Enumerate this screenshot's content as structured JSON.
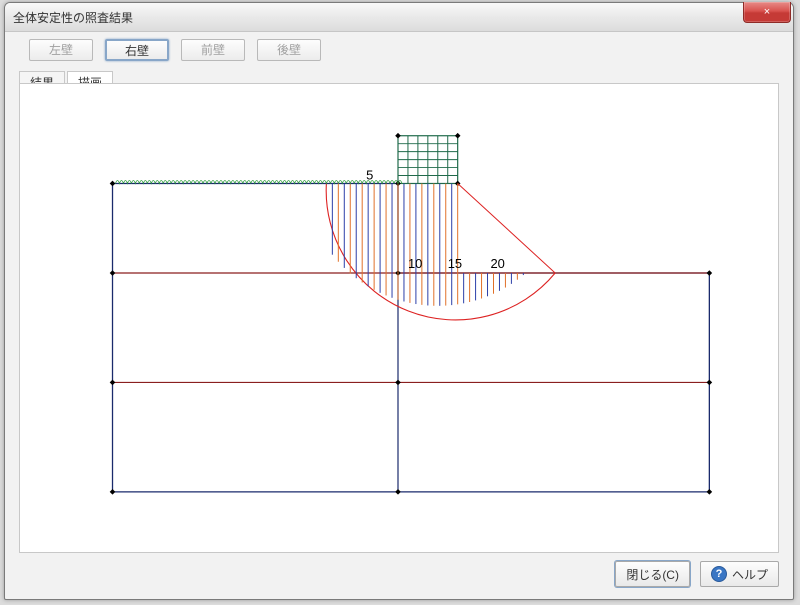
{
  "window": {
    "title": "全体安定性の照査結果",
    "close_icon": "×"
  },
  "wall_buttons": {
    "left": {
      "label": "左壁",
      "enabled": false
    },
    "right": {
      "label": "右壁",
      "enabled": true,
      "active": true
    },
    "front": {
      "label": "前壁",
      "enabled": false
    },
    "back": {
      "label": "後壁",
      "enabled": false
    }
  },
  "tabs": {
    "result": {
      "label": "結果"
    },
    "draw": {
      "label": "描画",
      "active": true
    }
  },
  "drawing": {
    "scale_labels": [
      "5",
      "10",
      "15",
      "20"
    ]
  },
  "buttons": {
    "close": "閉じる(C)",
    "help": "ヘルプ"
  }
}
